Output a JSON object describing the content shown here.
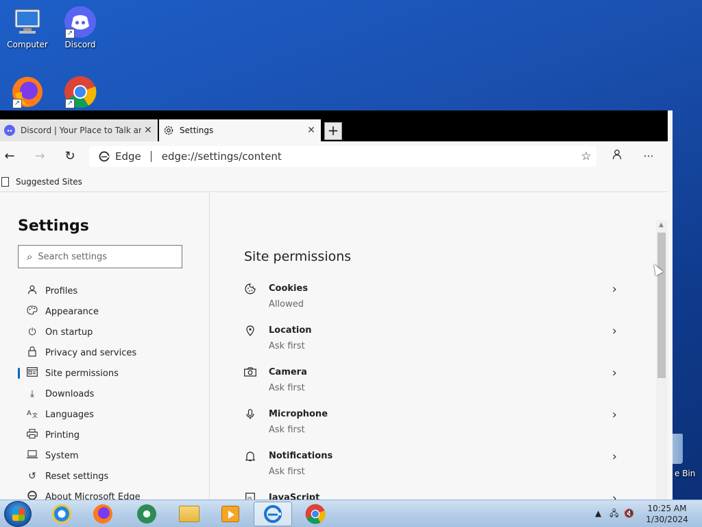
{
  "desktop": {
    "icons": [
      {
        "label": "Computer"
      },
      {
        "label": "Discord"
      },
      {
        "label": ""
      },
      {
        "label": ""
      }
    ],
    "recycle_bin_label": "e Bin"
  },
  "browser": {
    "tabs": [
      {
        "title": "Discord | Your Place to Talk and",
        "close": "✕"
      },
      {
        "title": "Settings",
        "close": "✕"
      }
    ],
    "new_tab": "+",
    "address": {
      "badge": "Edge",
      "url": "edge://settings/content"
    },
    "favorites_bar": {
      "item": "Suggested Sites"
    }
  },
  "sidebar": {
    "title": "Settings",
    "search_placeholder": "Search settings",
    "items": [
      {
        "label": "Profiles",
        "icon": "person-icon"
      },
      {
        "label": "Appearance",
        "icon": "palette-icon"
      },
      {
        "label": "On startup",
        "icon": "power-icon"
      },
      {
        "label": "Privacy and services",
        "icon": "lock-icon"
      },
      {
        "label": "Site permissions",
        "icon": "site-permissions-icon",
        "active": true
      },
      {
        "label": "Downloads",
        "icon": "download-icon"
      },
      {
        "label": "Languages",
        "icon": "languages-icon"
      },
      {
        "label": "Printing",
        "icon": "printer-icon"
      },
      {
        "label": "System",
        "icon": "laptop-icon"
      },
      {
        "label": "Reset settings",
        "icon": "reset-icon"
      },
      {
        "label": "About Microsoft Edge",
        "icon": "edge-icon"
      }
    ]
  },
  "content": {
    "heading": "Site permissions",
    "permissions": [
      {
        "name": "Cookies",
        "status": "Allowed",
        "icon": "cookie-icon"
      },
      {
        "name": "Location",
        "status": "Ask first",
        "icon": "location-pin-icon"
      },
      {
        "name": "Camera",
        "status": "Ask first",
        "icon": "camera-icon"
      },
      {
        "name": "Microphone",
        "status": "Ask first",
        "icon": "microphone-icon"
      },
      {
        "name": "Notifications",
        "status": "Ask first",
        "icon": "bell-icon"
      },
      {
        "name": "JavaScript",
        "status": "",
        "icon": "javascript-icon"
      }
    ]
  },
  "taskbar": {
    "clock_time": "10:25 AM",
    "clock_date": "1/30/2024"
  },
  "colors": {
    "accent": "#0067c0",
    "desktop": "#1a4fae",
    "taskbar": "#b6cfe8"
  }
}
